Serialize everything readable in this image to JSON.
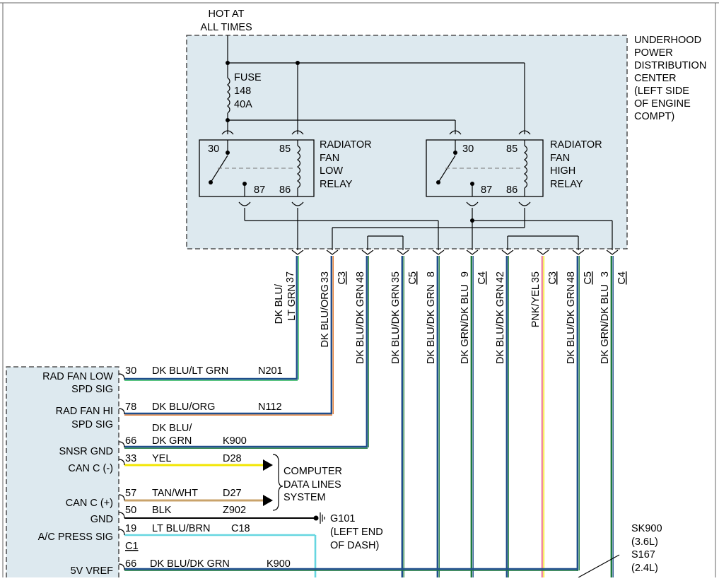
{
  "hot_label": [
    "HOT AT",
    "ALL TIMES"
  ],
  "updc_label": [
    "UNDERHOOD",
    "POWER",
    "DISTRIBUTION",
    "CENTER",
    "(LEFT SIDE",
    "OF ENGINE",
    "COMPT)"
  ],
  "fuse_label": [
    "FUSE",
    "148",
    "40A"
  ],
  "relays": [
    {
      "label": [
        "RADIATOR",
        "FAN",
        "LOW",
        "RELAY"
      ],
      "pins": [
        "30",
        "85",
        "87",
        "86"
      ]
    },
    {
      "label": [
        "RADIATOR",
        "FAN",
        "HIGH",
        "RELAY"
      ],
      "pins": [
        "30",
        "85",
        "87",
        "86"
      ]
    }
  ],
  "connector_pins": [
    {
      "pin": "37",
      "conn": "",
      "wire": "DK BLU/ LT GRN",
      "wire_lines": [
        "DK BLU/",
        "LT GRN"
      ]
    },
    {
      "pin": "33",
      "conn": "C3",
      "wire": "DK BLU/ORG"
    },
    {
      "pin": "48",
      "conn": "",
      "wire": "DK BLU/DK GRN"
    },
    {
      "pin": "35",
      "conn": "C5",
      "wire": "DK BLU/DK GRN"
    },
    {
      "pin": "8",
      "conn": "",
      "wire": "DK BLU/DK GRN"
    },
    {
      "pin": "9",
      "conn": "C4",
      "wire": "DK GRN/DK BLU"
    },
    {
      "pin": "42",
      "conn": "",
      "wire": "DK BLU/DK GRN"
    },
    {
      "pin": "35",
      "conn": "C3",
      "wire": "PNK/YEL"
    },
    {
      "pin": "48",
      "conn": "C5",
      "wire": "DK BLU/DK GRN"
    },
    {
      "pin": "3",
      "conn": "C4",
      "wire": "DK GRN/DK BLU"
    }
  ],
  "module_signals": [
    {
      "label": [
        "RAD FAN LOW",
        "SPD SIG"
      ],
      "pin": "30",
      "wire": "DK BLU/LT GRN",
      "circuit": "N201"
    },
    {
      "label": [
        "RAD FAN HI",
        "SPD SIG"
      ],
      "pin": "78",
      "wire": "DK BLU/ORG",
      "circuit": "N112"
    },
    {
      "label": [
        "SNSR GND"
      ],
      "pin": "66",
      "wire": "DK BLU/ DK GRN",
      "wire_lines": [
        "DK BLU/",
        "DK GRN"
      ],
      "circuit": "K900"
    },
    {
      "label": [
        "CAN C (-)"
      ],
      "pin": "33",
      "wire": "YEL",
      "circuit": "D28"
    },
    {
      "label": [
        "CAN C (+)"
      ],
      "pin": "57",
      "wire": "TAN/WHT",
      "circuit": "D27"
    },
    {
      "label": [
        "GND"
      ],
      "pin": "50",
      "wire": "BLK",
      "circuit": "Z902"
    },
    {
      "label": [
        "A/C PRESS SIG"
      ],
      "pin": "19",
      "wire": "LT BLU/BRN",
      "circuit": "C18"
    },
    {
      "label": [
        "5V VREF"
      ],
      "pin": "66",
      "wire": "DK BLU/DK GRN",
      "circuit": "K900"
    }
  ],
  "module_connector": "C1",
  "data_lines_label": [
    "COMPUTER",
    "DATA LINES",
    "SYSTEM"
  ],
  "ground_label": [
    "G101",
    "(LEFT END",
    "OF DASH)"
  ],
  "splice_label": [
    "SK900",
    "(3.6L)",
    "S167",
    "(2.4L)"
  ],
  "wire_colors": {
    "dk_blu": "#1f4e8c",
    "dk_grn": "#1d7a3c",
    "lt_grn": "#3fbf6a",
    "org": "#e07020",
    "pnk": "#f08aa0",
    "yel": "#f2e600",
    "tan": "#c9a36b",
    "blk": "#000000",
    "lt_blu": "#66d6e0",
    "brn": "#8a5a2b"
  }
}
